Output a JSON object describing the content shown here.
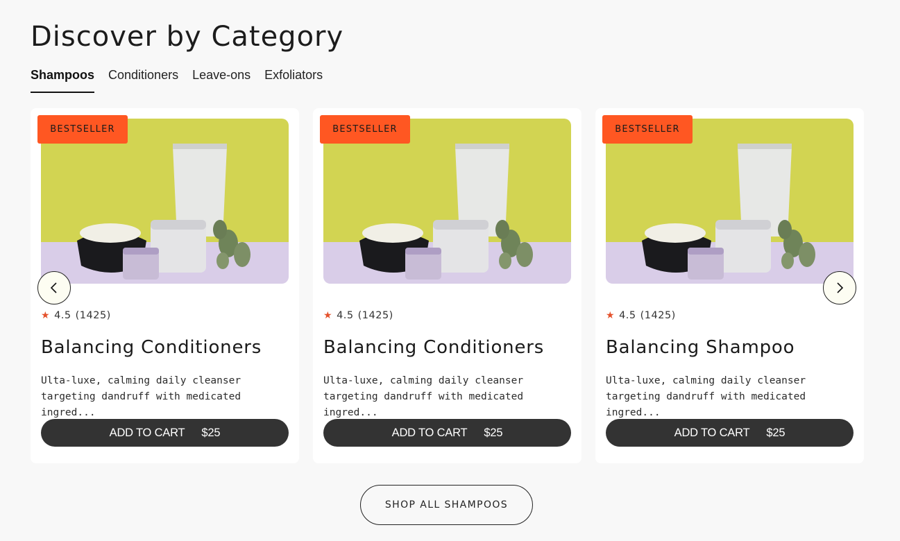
{
  "section": {
    "heading": "Discover by Category",
    "shop_all_label": "SHOP ALL SHAMPOOS"
  },
  "tabs": [
    {
      "label": "Shampoos",
      "active": true
    },
    {
      "label": "Conditioners",
      "active": false
    },
    {
      "label": "Leave-ons",
      "active": false
    },
    {
      "label": "Exfoliators",
      "active": false
    }
  ],
  "products": [
    {
      "badge": "BESTSELLER",
      "rating": "4.5",
      "reviews": "(1425)",
      "title": "Balancing Conditioners",
      "description": "Ulta-luxe, calming daily cleanser targeting dandruff with medicated ingred...",
      "cart_label": "ADD TO CART",
      "price": "$25"
    },
    {
      "badge": "BESTSELLER",
      "rating": "4.5",
      "reviews": "(1425)",
      "title": "Balancing Conditioners",
      "description": "Ulta-luxe, calming daily cleanser targeting dandruff with medicated ingred...",
      "cart_label": "ADD TO CART",
      "price": "$25"
    },
    {
      "badge": "BESTSELLER",
      "rating": "4.5",
      "reviews": "(1425)",
      "title": "Balancing Shampoo",
      "description": "Ulta-luxe, calming daily cleanser targeting dandruff with medicated ingred...",
      "cart_label": "ADD TO CART",
      "price": "$25"
    }
  ],
  "icons": {
    "star": "star-icon",
    "prev": "chevron-left-icon",
    "next": "chevron-right-icon"
  },
  "colors": {
    "badge": "#ff5722",
    "star": "#e4512b",
    "cart_button": "#333333",
    "image_wall": "#d2d452",
    "image_table": "#d9cde8"
  }
}
